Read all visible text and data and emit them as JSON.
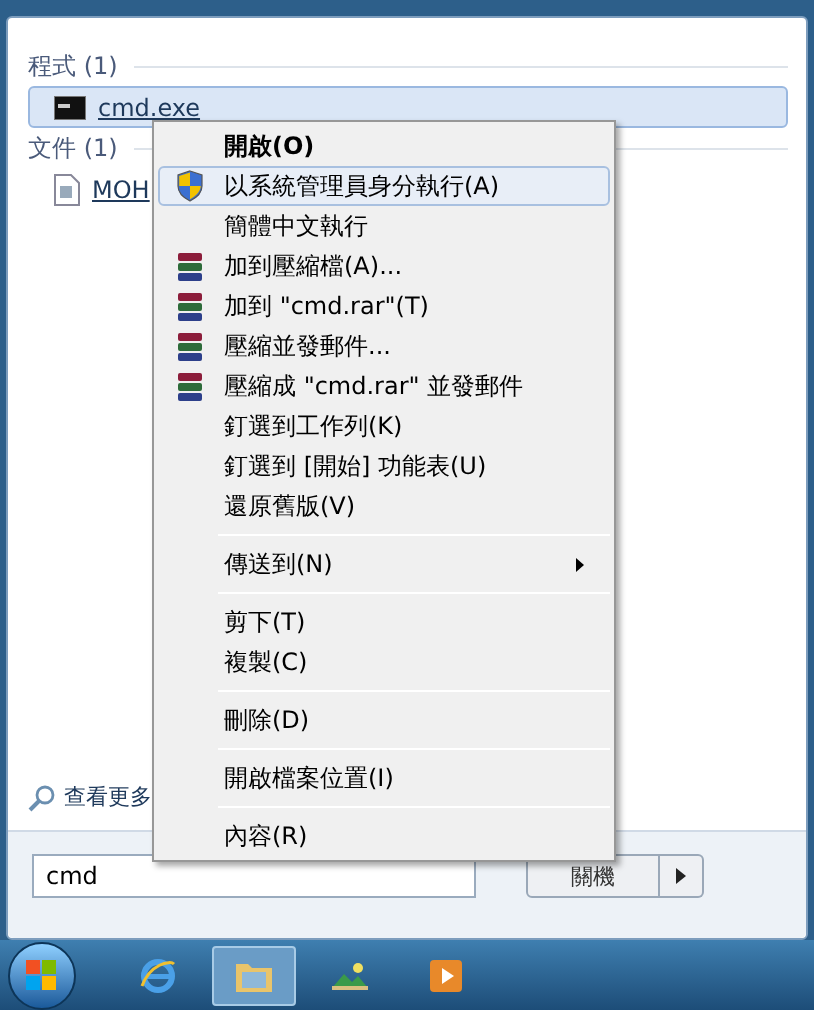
{
  "sections": [
    {
      "title": "程式 (1)",
      "items": [
        {
          "label": "cmd.exe",
          "kind": "console",
          "selected": true
        }
      ]
    },
    {
      "title": "文件 (1)",
      "items": [
        {
          "label": "MOH",
          "kind": "document",
          "selected": false
        }
      ]
    }
  ],
  "more_results": "查看更多",
  "search": {
    "value": "cmd"
  },
  "shutdown": {
    "label": "關機"
  },
  "context_menu": {
    "groups": [
      [
        {
          "label": "開啟(O)",
          "kind": "plain",
          "default": true,
          "highlighted": false,
          "submenu": false
        },
        {
          "label": "以系統管理員身分執行(A)",
          "kind": "shield",
          "default": false,
          "highlighted": true,
          "submenu": false
        },
        {
          "label": "簡體中文執行",
          "kind": "plain",
          "default": false,
          "highlighted": false,
          "submenu": false
        },
        {
          "label": "加到壓縮檔(A)...",
          "kind": "archive",
          "default": false,
          "highlighted": false,
          "submenu": false
        },
        {
          "label": "加到 \"cmd.rar\"(T)",
          "kind": "archive",
          "default": false,
          "highlighted": false,
          "submenu": false
        },
        {
          "label": "壓縮並發郵件...",
          "kind": "archive",
          "default": false,
          "highlighted": false,
          "submenu": false
        },
        {
          "label": "壓縮成 \"cmd.rar\" 並發郵件",
          "kind": "archive",
          "default": false,
          "highlighted": false,
          "submenu": false
        },
        {
          "label": "釘選到工作列(K)",
          "kind": "plain",
          "default": false,
          "highlighted": false,
          "submenu": false
        },
        {
          "label": "釘選到 [開始] 功能表(U)",
          "kind": "plain",
          "default": false,
          "highlighted": false,
          "submenu": false
        },
        {
          "label": "還原舊版(V)",
          "kind": "plain",
          "default": false,
          "highlighted": false,
          "submenu": false
        }
      ],
      [
        {
          "label": "傳送到(N)",
          "kind": "plain",
          "default": false,
          "highlighted": false,
          "submenu": true
        }
      ],
      [
        {
          "label": "剪下(T)",
          "kind": "plain",
          "default": false,
          "highlighted": false,
          "submenu": false
        },
        {
          "label": "複製(C)",
          "kind": "plain",
          "default": false,
          "highlighted": false,
          "submenu": false
        }
      ],
      [
        {
          "label": "刪除(D)",
          "kind": "plain",
          "default": false,
          "highlighted": false,
          "submenu": false
        }
      ],
      [
        {
          "label": "開啟檔案位置(I)",
          "kind": "plain",
          "default": false,
          "highlighted": false,
          "submenu": false
        }
      ],
      [
        {
          "label": "內容(R)",
          "kind": "plain",
          "default": false,
          "highlighted": false,
          "submenu": false
        }
      ]
    ]
  },
  "taskbar": [
    {
      "kind": "browser",
      "selected": false
    },
    {
      "kind": "folder",
      "selected": true
    },
    {
      "kind": "photos",
      "selected": false
    },
    {
      "kind": "media",
      "selected": false
    }
  ]
}
